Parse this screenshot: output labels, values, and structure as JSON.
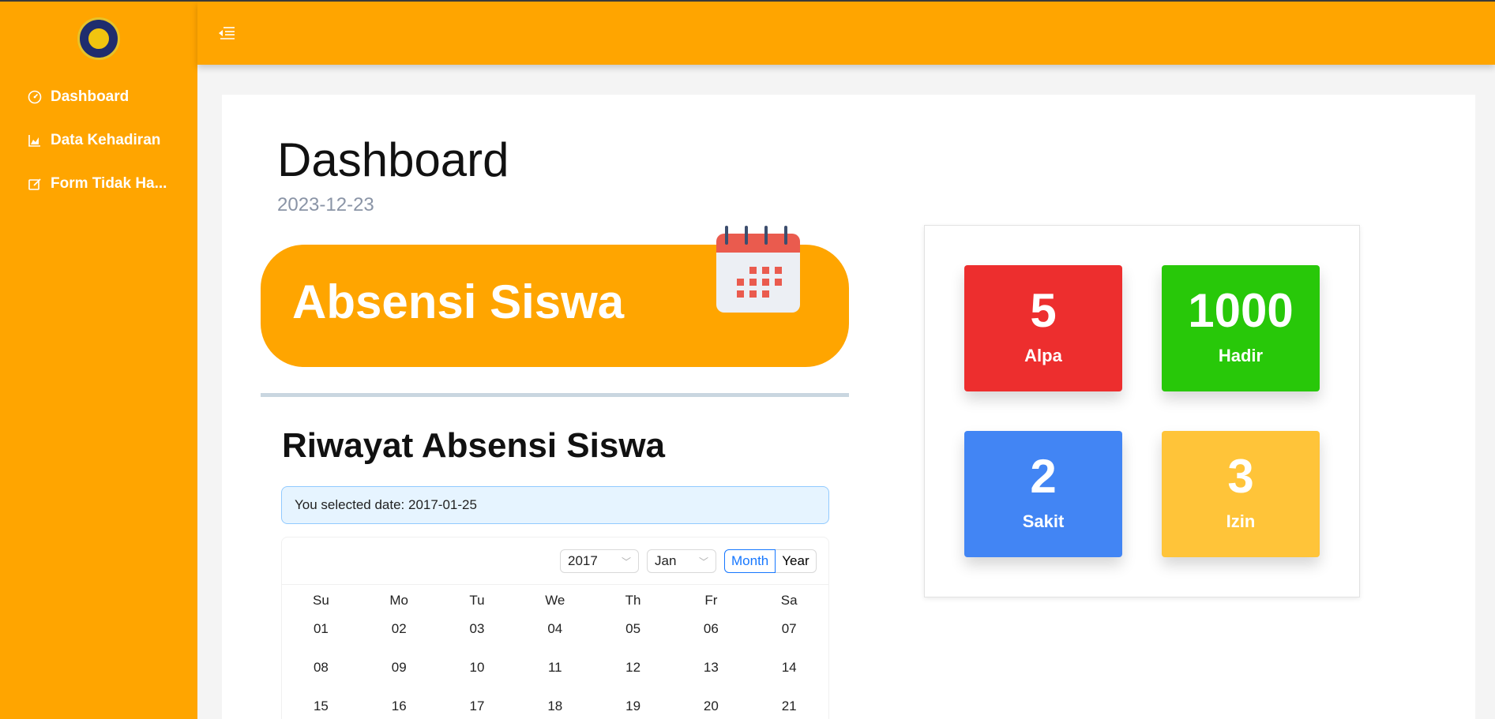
{
  "sidebar": {
    "items": [
      {
        "label": "Dashboard",
        "icon": "gauge-icon"
      },
      {
        "label": "Data Kehadiran",
        "icon": "area-chart-icon"
      },
      {
        "label": "Form Tidak Ha...",
        "icon": "edit-icon"
      }
    ]
  },
  "header": {
    "menu_icon": "menu-fold-icon"
  },
  "page": {
    "title": "Dashboard",
    "date": "2023-12-23"
  },
  "banner": {
    "title": "Absensi Siswa",
    "icon": "calendar-icon"
  },
  "history": {
    "title": "Riwayat Absensi Siswa",
    "alert": "You selected date: 2017-01-25",
    "calendar": {
      "year": "2017",
      "month": "Jan",
      "modes": [
        "Month",
        "Year"
      ],
      "active_mode": "Month",
      "weekdays": [
        "Su",
        "Mo",
        "Tu",
        "We",
        "Th",
        "Fr",
        "Sa"
      ],
      "weeks": [
        [
          "01",
          "02",
          "03",
          "04",
          "05",
          "06",
          "07"
        ],
        [
          "08",
          "09",
          "10",
          "11",
          "12",
          "13",
          "14"
        ],
        [
          "15",
          "16",
          "17",
          "18",
          "19",
          "20",
          "21"
        ]
      ]
    }
  },
  "stats": [
    {
      "value": "5",
      "label": "Alpa",
      "color": "#ed2e2e"
    },
    {
      "value": "1000",
      "label": "Hadir",
      "color": "#28c809"
    },
    {
      "value": "2",
      "label": "Sakit",
      "color": "#4285f4"
    },
    {
      "value": "3",
      "label": "Izin",
      "color": "#ffc439"
    }
  ],
  "colors": {
    "brand": "#ffa500",
    "sidebar_text": "#ffffff",
    "accent": "#1677ff"
  }
}
